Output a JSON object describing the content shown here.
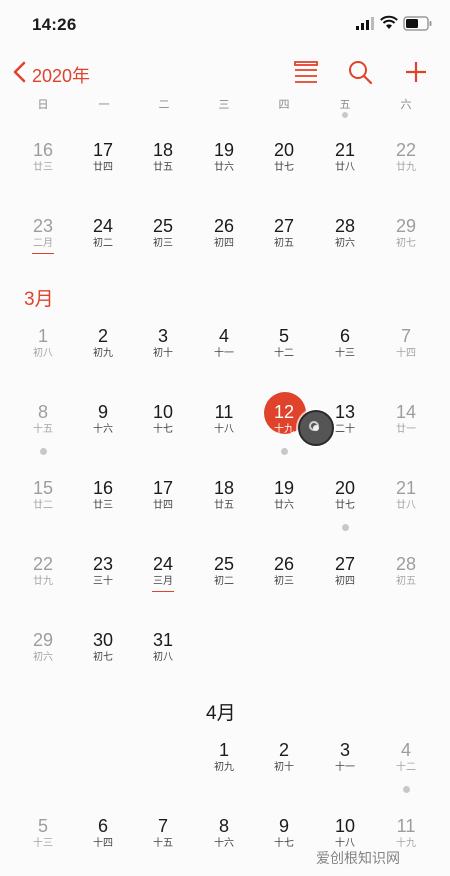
{
  "status": {
    "time": "14:26"
  },
  "nav": {
    "year_label": "2020年"
  },
  "weekdays": [
    "日",
    "一",
    "二",
    "三",
    "四",
    "五",
    "六"
  ],
  "colors": {
    "accent": "#e0432b",
    "dim": "#9d9d9d"
  },
  "months": {
    "march": "3月",
    "april": "4月"
  },
  "weeks": [
    [
      [
        "16",
        "廿三"
      ],
      [
        "17",
        "廿四"
      ],
      [
        "18",
        "廿五"
      ],
      [
        "19",
        "廿六"
      ],
      [
        "20",
        "廿七"
      ],
      [
        "21",
        "廿八"
      ],
      [
        "22",
        "廿九"
      ]
    ],
    [
      [
        "23",
        "二月"
      ],
      [
        "24",
        "初二"
      ],
      [
        "25",
        "初三"
      ],
      [
        "26",
        "初四"
      ],
      [
        "27",
        "初五"
      ],
      [
        "28",
        "初六"
      ],
      [
        "29",
        "初七"
      ]
    ],
    [
      [
        "1",
        "初八"
      ],
      [
        "2",
        "初九"
      ],
      [
        "3",
        "初十"
      ],
      [
        "4",
        "十一"
      ],
      [
        "5",
        "十二"
      ],
      [
        "6",
        "十三"
      ],
      [
        "7",
        "十四"
      ]
    ],
    [
      [
        "8",
        "十五"
      ],
      [
        "9",
        "十六"
      ],
      [
        "10",
        "十七"
      ],
      [
        "11",
        "十八"
      ],
      [
        "12",
        "十九"
      ],
      [
        "13",
        "二十"
      ],
      [
        "14",
        "廿一"
      ]
    ],
    [
      [
        "15",
        "廿二"
      ],
      [
        "16",
        "廿三"
      ],
      [
        "17",
        "廿四"
      ],
      [
        "18",
        "廿五"
      ],
      [
        "19",
        "廿六"
      ],
      [
        "20",
        "廿七"
      ],
      [
        "21",
        "廿八"
      ]
    ],
    [
      [
        "22",
        "廿九"
      ],
      [
        "23",
        "三十"
      ],
      [
        "24",
        "三月"
      ],
      [
        "25",
        "初二"
      ],
      [
        "26",
        "初三"
      ],
      [
        "27",
        "初四"
      ],
      [
        "28",
        "初五"
      ]
    ],
    [
      [
        "29",
        "初六"
      ],
      [
        "30",
        "初七"
      ],
      [
        "31",
        "初八"
      ]
    ],
    [
      [
        "1",
        "初九"
      ],
      [
        "2",
        "初十"
      ],
      [
        "3",
        "十一"
      ],
      [
        "4",
        "十二"
      ]
    ],
    [
      [
        "5",
        "十三"
      ],
      [
        "6",
        "十四"
      ],
      [
        "7",
        "十五"
      ],
      [
        "8",
        "十六"
      ],
      [
        "9",
        "十七"
      ],
      [
        "10",
        "十八"
      ],
      [
        "11",
        "十九"
      ]
    ]
  ],
  "watermark": "爱创根知识网"
}
